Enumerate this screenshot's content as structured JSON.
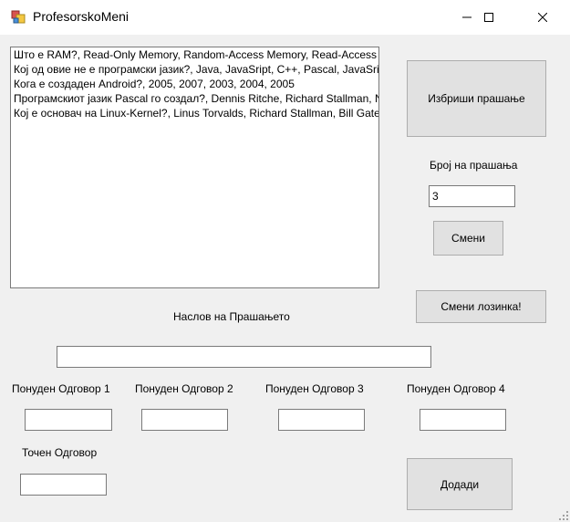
{
  "window": {
    "title": "ProfesorskoMeni"
  },
  "questions": {
    "items": [
      "Што е RAM?, Read-Only Memory, Random-Access Memory, Read-Access Memory, Random-Access Memory",
      "Кој од овие не е програмски јазик?, Java, JavaSript, C++, Pascal, JavaSript",
      "Кога е создаден Android?, 2005, 2007, 2003, 2004, 2005",
      "Програмскиот јазик Pascal го создал?, Dennis Ritche, Richard Stallman, Niklaus Wirth, Bjarne Stroustrup, Niklaus Wirth",
      "Кој е основач на Linux-Kernel?, Linus Torvalds, Richard Stallman, Bill Gates, Steve Jobs, Linus Torvalds"
    ]
  },
  "buttons": {
    "delete_question": "Избриши прашање",
    "change": "Смени",
    "change_password": "Смени лозинка!",
    "add": "Додади"
  },
  "labels": {
    "question_count": "Број на прашања",
    "question_title": "Наслов на Прашањето",
    "answer1": "Понуден Одговор 1",
    "answer2": "Понуден Одговор 2",
    "answer3": "Понуден Одговор 3",
    "answer4": "Понуден Одговор 4",
    "correct_answer": "Точен Одговор"
  },
  "inputs": {
    "question_count_value": "3",
    "question_title_value": "",
    "answer1_value": "",
    "answer2_value": "",
    "answer3_value": "",
    "answer4_value": "",
    "correct_answer_value": ""
  }
}
